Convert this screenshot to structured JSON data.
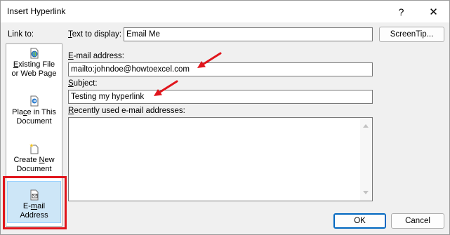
{
  "window": {
    "title": "Insert Hyperlink",
    "help_glyph": "?",
    "close_glyph": "✕"
  },
  "link_to": {
    "label": "Link to:",
    "items": [
      {
        "line1": "Existing File",
        "line2": "or Web Page",
        "icon": "globe-document-icon"
      },
      {
        "line1": "Place in This",
        "line2": "Document",
        "icon": "document-arrow-icon"
      },
      {
        "line1": "Create New",
        "line2": "Document",
        "icon": "new-document-icon"
      },
      {
        "line1": "E-mail",
        "line2": "Address",
        "icon": "email-document-icon",
        "selected": true
      }
    ]
  },
  "text_to_display": {
    "label": "Text to display:",
    "value": "Email Me"
  },
  "screentip_button": "ScreenTip...",
  "email_address": {
    "label": "E-mail address:",
    "value": "mailto:johndoe@howtoexcel.com"
  },
  "subject": {
    "label": "Subject:",
    "value": "Testing my hyperlink"
  },
  "recent_addresses": {
    "label": "Recently used e-mail addresses:",
    "items": []
  },
  "buttons": {
    "ok": "OK",
    "cancel": "Cancel"
  },
  "colors": {
    "annotation_red": "#e0151c",
    "selected_bg": "#cde6f7",
    "primary_border": "#0067c0"
  }
}
